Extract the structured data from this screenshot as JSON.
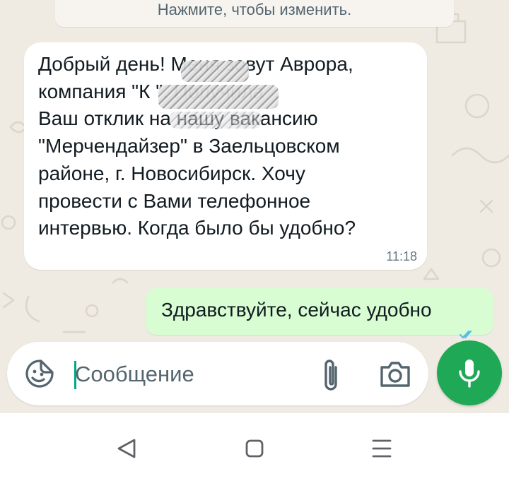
{
  "banner": {
    "text": "Нажмите, чтобы изменить."
  },
  "messages": [
    {
      "direction": "incoming",
      "lines": [
        "Добрый день! Меня зовут Аврора,",
        "компания \"К            \". Получила",
        "Ваш отклик на нашу вакансию",
        "\"Мерчендайзер\" в Заельцовском",
        "районе, г. Новосибирск. Хочу",
        "провести с Вами телефонное",
        "интервью. Когда было бы удобно?"
      ],
      "time": "11:18"
    },
    {
      "direction": "outgoing",
      "text": "Здравствуйте, сейчас удобно"
    }
  ],
  "composer": {
    "placeholder": "Сообщение",
    "icons": {
      "emoji": "sticker-emoji-icon",
      "attach": "paperclip-icon",
      "camera": "camera-icon",
      "mic": "microphone-icon"
    }
  },
  "nav": {
    "icons": [
      "back-triangle-icon",
      "home-square-icon",
      "menu-lines-icon"
    ]
  },
  "colors": {
    "chat_background": "#efeae2",
    "incoming_bubble": "#ffffff",
    "outgoing_bubble": "#d9fdd3",
    "accent": "#1fa855",
    "text": "#111b21",
    "muted": "#667781"
  }
}
